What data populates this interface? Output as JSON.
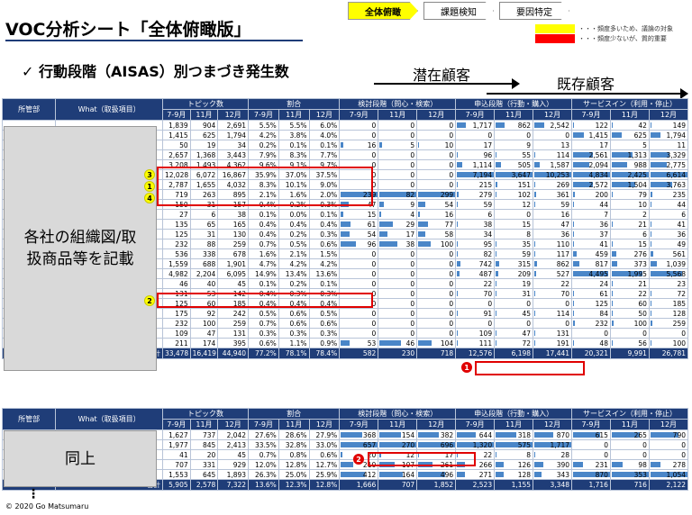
{
  "title": "VOC分析シート「全体俯瞰版」",
  "steps": [
    "全体俯瞰",
    "課題検知",
    "要因特定"
  ],
  "legend": [
    {
      "label": "・・・頻度多いため、議論の対象",
      "color": "#ffff00"
    },
    {
      "label": "・・・頻度少ないが、質的重要",
      "color": "#ff0000"
    }
  ],
  "subtitle": "✓ 行動段階（AISAS）別つまづき発生数",
  "latent": "潜在顧客",
  "existing": "既存顧客",
  "headers": {
    "dept": "所管部",
    "what": "What（取扱項目）",
    "topics": "トピック数",
    "ratio": "割合",
    "g1": "検討段階（問心・検索）",
    "g2": "申込段階（行動・購入）",
    "g3": "サービスイン（利用・停止）",
    "m": [
      "7-9月",
      "11月",
      "12月"
    ]
  },
  "t1": {
    "cover": "各社の組織図/取扱商品等を記載",
    "rows": [
      [
        1839,
        904,
        2691,
        "5.5%",
        "5.5%",
        "6.0%",
        0,
        0,
        0,
        1717,
        862,
        2542,
        122,
        42,
        149
      ],
      [
        1415,
        625,
        1794,
        "4.2%",
        "3.8%",
        "4.0%",
        0,
        0,
        0,
        0,
        0,
        0,
        1415,
        625,
        1794
      ],
      [
        50,
        19,
        34,
        "0.2%",
        "0.1%",
        "0.1%",
        16,
        5,
        10,
        17,
        9,
        13,
        17,
        5,
        11
      ],
      [
        2657,
        1368,
        3443,
        "7.9%",
        "8.3%",
        "7.7%",
        0,
        0,
        0,
        96,
        55,
        114,
        2561,
        1313,
        3329
      ],
      [
        3208,
        1493,
        4362,
        "9.6%",
        "9.1%",
        "9.7%",
        0,
        0,
        0,
        1114,
        505,
        1587,
        2094,
        988,
        2775
      ],
      [
        12028,
        6072,
        16867,
        "35.9%",
        "37.0%",
        "37.5%",
        0,
        0,
        0,
        7194,
        3647,
        10253,
        4834,
        2425,
        6614
      ],
      [
        2787,
        1655,
        4032,
        "8.3%",
        "10.1%",
        "9.0%",
        0,
        0,
        0,
        215,
        151,
        269,
        2572,
        1504,
        3763
      ],
      [
        719,
        263,
        895,
        "2.1%",
        "1.6%",
        "2.0%",
        239,
        82,
        299,
        279,
        102,
        361,
        200,
        79,
        235
      ],
      [
        150,
        31,
        157,
        "0.4%",
        "0.2%",
        "0.3%",
        47,
        9,
        54,
        59,
        12,
        59,
        44,
        10,
        44
      ],
      [
        27,
        6,
        38,
        "0.1%",
        "0.0%",
        "0.1%",
        15,
        4,
        16,
        6,
        0,
        16,
        7,
        2,
        6
      ],
      [
        135,
        65,
        165,
        "0.4%",
        "0.4%",
        "0.4%",
        61,
        29,
        77,
        38,
        15,
        47,
        36,
        21,
        41
      ],
      [
        125,
        31,
        130,
        "0.4%",
        "0.2%",
        "0.3%",
        54,
        17,
        58,
        34,
        8,
        36,
        37,
        6,
        36
      ],
      [
        232,
        88,
        259,
        "0.7%",
        "0.5%",
        "0.6%",
        96,
        38,
        100,
        95,
        35,
        110,
        41,
        15,
        49
      ],
      [
        536,
        338,
        678,
        "1.6%",
        "2.1%",
        "1.5%",
        0,
        0,
        0,
        82,
        59,
        117,
        459,
        276,
        561
      ],
      [
        1559,
        688,
        1901,
        "4.7%",
        "4.2%",
        "4.2%",
        0,
        0,
        0,
        742,
        315,
        862,
        817,
        373,
        1039
      ],
      [
        4982,
        2204,
        6095,
        "14.9%",
        "13.4%",
        "13.6%",
        0,
        0,
        0,
        487,
        209,
        527,
        4495,
        1995,
        5568
      ],
      [
        46,
        40,
        45,
        "0.1%",
        "0.2%",
        "0.1%",
        0,
        0,
        0,
        22,
        19,
        22,
        24,
        21,
        23
      ],
      [
        131,
        53,
        142,
        "0.4%",
        "0.3%",
        "0.3%",
        0,
        0,
        0,
        70,
        31,
        70,
        61,
        22,
        72
      ],
      [
        125,
        60,
        185,
        "0.4%",
        "0.4%",
        "0.4%",
        0,
        0,
        0,
        0,
        0,
        0,
        125,
        60,
        185
      ],
      [
        175,
        92,
        242,
        "0.5%",
        "0.6%",
        "0.5%",
        0,
        0,
        0,
        91,
        45,
        114,
        84,
        50,
        128
      ],
      [
        232,
        100,
        259,
        "0.7%",
        "0.6%",
        "0.6%",
        0,
        0,
        0,
        0,
        0,
        0,
        232,
        100,
        259
      ],
      [
        109,
        47,
        131,
        "0.3%",
        "0.3%",
        "0.3%",
        0,
        0,
        0,
        109,
        47,
        131,
        0,
        0,
        0
      ],
      [
        211,
        174,
        395,
        "0.6%",
        "1.1%",
        "0.9%",
        53,
        46,
        104,
        111,
        72,
        191,
        48,
        56,
        100
      ]
    ],
    "total": [
      "合計",
      33478,
      16419,
      44940,
      "77.2%",
      "78.1%",
      "78.4%",
      582,
      230,
      718,
      12576,
      6198,
      17441,
      20321,
      9991,
      26781
    ]
  },
  "t2": {
    "cover": "同上",
    "rows": [
      [
        1627,
        737,
        2042,
        "27.6%",
        "28.6%",
        "27.9%",
        368,
        154,
        382,
        644,
        318,
        870,
        615,
        265,
        790
      ],
      [
        1977,
        845,
        2413,
        "33.5%",
        "32.8%",
        "33.0%",
        657,
        270,
        696,
        1320,
        575,
        1717,
        0,
        0,
        0
      ],
      [
        41,
        20,
        45,
        "0.7%",
        "0.8%",
        "0.6%",
        20,
        12,
        17,
        22,
        8,
        28,
        0,
        0,
        0
      ],
      [
        707,
        331,
        929,
        "12.0%",
        "12.8%",
        "12.7%",
        210,
        107,
        261,
        266,
        126,
        390,
        231,
        98,
        278
      ],
      [
        1553,
        645,
        1893,
        "26.3%",
        "25.0%",
        "25.9%",
        412,
        164,
        496,
        271,
        128,
        343,
        870,
        353,
        1054
      ]
    ],
    "total": [
      "合計",
      5905,
      2578,
      7322,
      "13.6%",
      "12.3%",
      "12.8%",
      1666,
      707,
      1852,
      2523,
      1155,
      3348,
      1716,
      716,
      2122
    ]
  },
  "badges": [
    "3",
    "1",
    "4",
    "2",
    "1",
    "2"
  ],
  "copyright": "© 2020 Go Matsumaru",
  "ellipsis": "⋮"
}
